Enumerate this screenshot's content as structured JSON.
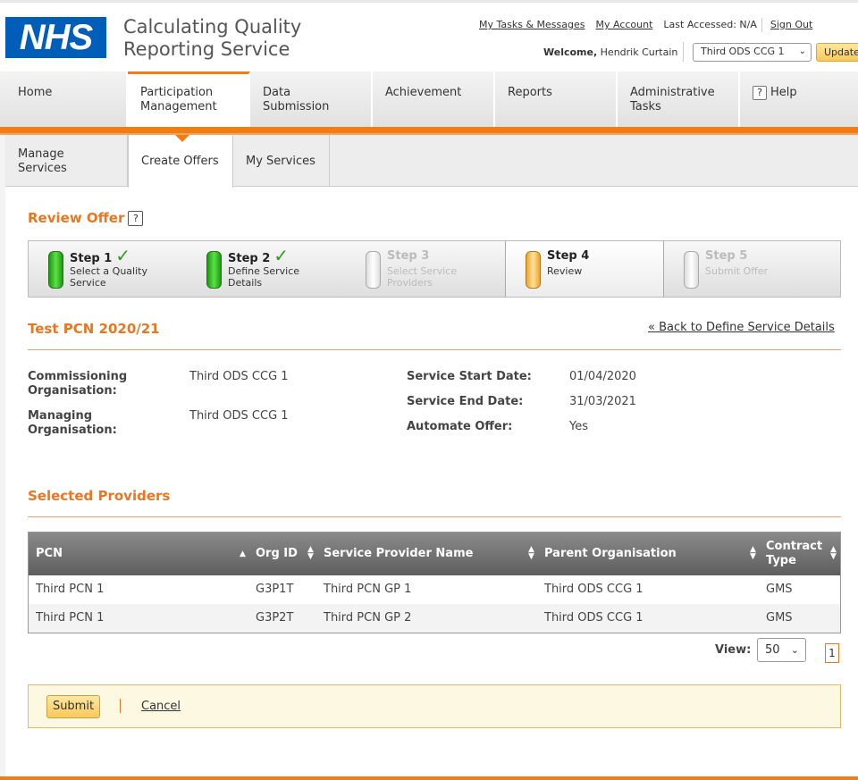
{
  "header": {
    "logo_text": "NHS",
    "app_title_line1": "Calculating Quality",
    "app_title_line2": "Reporting Service",
    "links": {
      "tasks": "My Tasks & Messages",
      "account": "My Account",
      "last_accessed": "Last Accessed: N/A",
      "sign_out": "Sign Out"
    },
    "welcome_label": "Welcome,",
    "user_name": "Hendrik Curtain",
    "org_select_value": "Third ODS CCG 1",
    "update_label": "Update"
  },
  "mainnav": {
    "tabs": [
      {
        "label": "Home"
      },
      {
        "label": "Participation Management",
        "active": true
      },
      {
        "label": "Data Submission"
      },
      {
        "label": "Achievement"
      },
      {
        "label": "Reports"
      },
      {
        "label": "Administrative Tasks"
      },
      {
        "label": "Help"
      }
    ]
  },
  "subnav": {
    "tabs": [
      {
        "label": "Manage Services"
      },
      {
        "label": "Create Offers",
        "active": true
      },
      {
        "label": "My Services"
      }
    ]
  },
  "page": {
    "title": "Review Offer",
    "help_glyph": "?"
  },
  "steps": [
    {
      "name": "Step 1",
      "desc": "Select a Quality Service",
      "state": "complete"
    },
    {
      "name": "Step 2",
      "desc": "Define Service Details",
      "state": "complete"
    },
    {
      "name": "Step 3",
      "desc": "Select Service Providers",
      "state": "disabled"
    },
    {
      "name": "Step 4",
      "desc": "Review",
      "state": "current"
    },
    {
      "name": "Step 5",
      "desc": "Submit Offer",
      "state": "disabled"
    }
  ],
  "offer": {
    "title": "Test PCN 2020/21",
    "back_link": "« Back to Define Service Details",
    "commissioning_label": "Commissioning Organisation:",
    "commissioning_value": "Third ODS CCG 1",
    "managing_label": "Managing Organisation:",
    "managing_value": "Third ODS CCG 1",
    "start_label": "Service Start Date:",
    "start_value": "01/04/2020",
    "end_label": "Service End Date:",
    "end_value": "31/03/2021",
    "automate_label": "Automate Offer:",
    "automate_value": "Yes"
  },
  "providers": {
    "title": "Selected Providers",
    "columns": [
      "PCN",
      "Org ID",
      "Service Provider Name",
      "Parent Organisation",
      "Contract Type"
    ],
    "rows": [
      [
        "Third PCN 1",
        "G3P1T",
        "Third PCN GP 1",
        "Third ODS CCG 1",
        "GMS"
      ],
      [
        "Third PCN 1",
        "G3P2T",
        "Third PCN GP 2",
        "Third ODS CCG 1",
        "GMS"
      ]
    ],
    "view_label": "View:",
    "view_value": "50",
    "page": "1"
  },
  "actions": {
    "submit_label": "Submit",
    "cancel_label": "Cancel"
  },
  "colors": {
    "brand_blue": "#005eb8",
    "accent_orange": "#f07e14",
    "heading_orange": "#e87722"
  }
}
